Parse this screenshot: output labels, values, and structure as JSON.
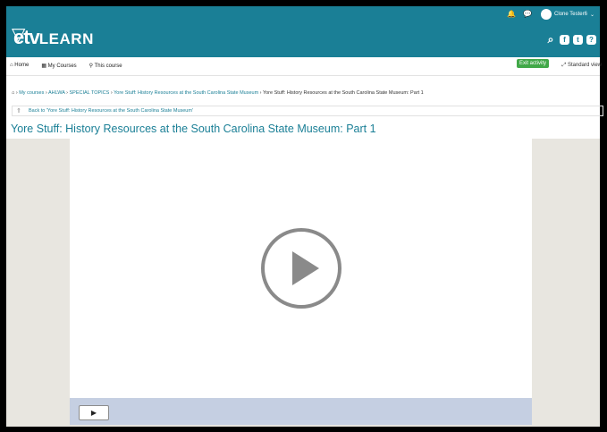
{
  "topbar": {
    "user_name": "Clone Tester6"
  },
  "brand": {
    "logo_prefix": "etv",
    "logo_suffix": "LEARN"
  },
  "nav": {
    "home": "Home",
    "my_courses": "My Courses",
    "this_course": "This course"
  },
  "actions": {
    "exit_activity": "Exit activity",
    "standard_view": "Standard view"
  },
  "breadcrumb": {
    "my_courses": "My courses",
    "ahlwa": "AHLWA",
    "special_topics": "SPECIAL TOPICS",
    "resource_link": "Yore Stuff: History Resources at the South Carolina State Museum",
    "current": "Yore Stuff: History Resources at the South Carolina State Museum: Part 1"
  },
  "back_link": "Back to 'Yore Stuff: History Resources at the South Carolina State Museum'",
  "page_title": "Yore Stuff: History Resources at the South Carolina State Museum: Part 1",
  "colors": {
    "brand": "#1a7f96",
    "exit_button": "#41a848",
    "player_controls": "#c5cfe2"
  }
}
